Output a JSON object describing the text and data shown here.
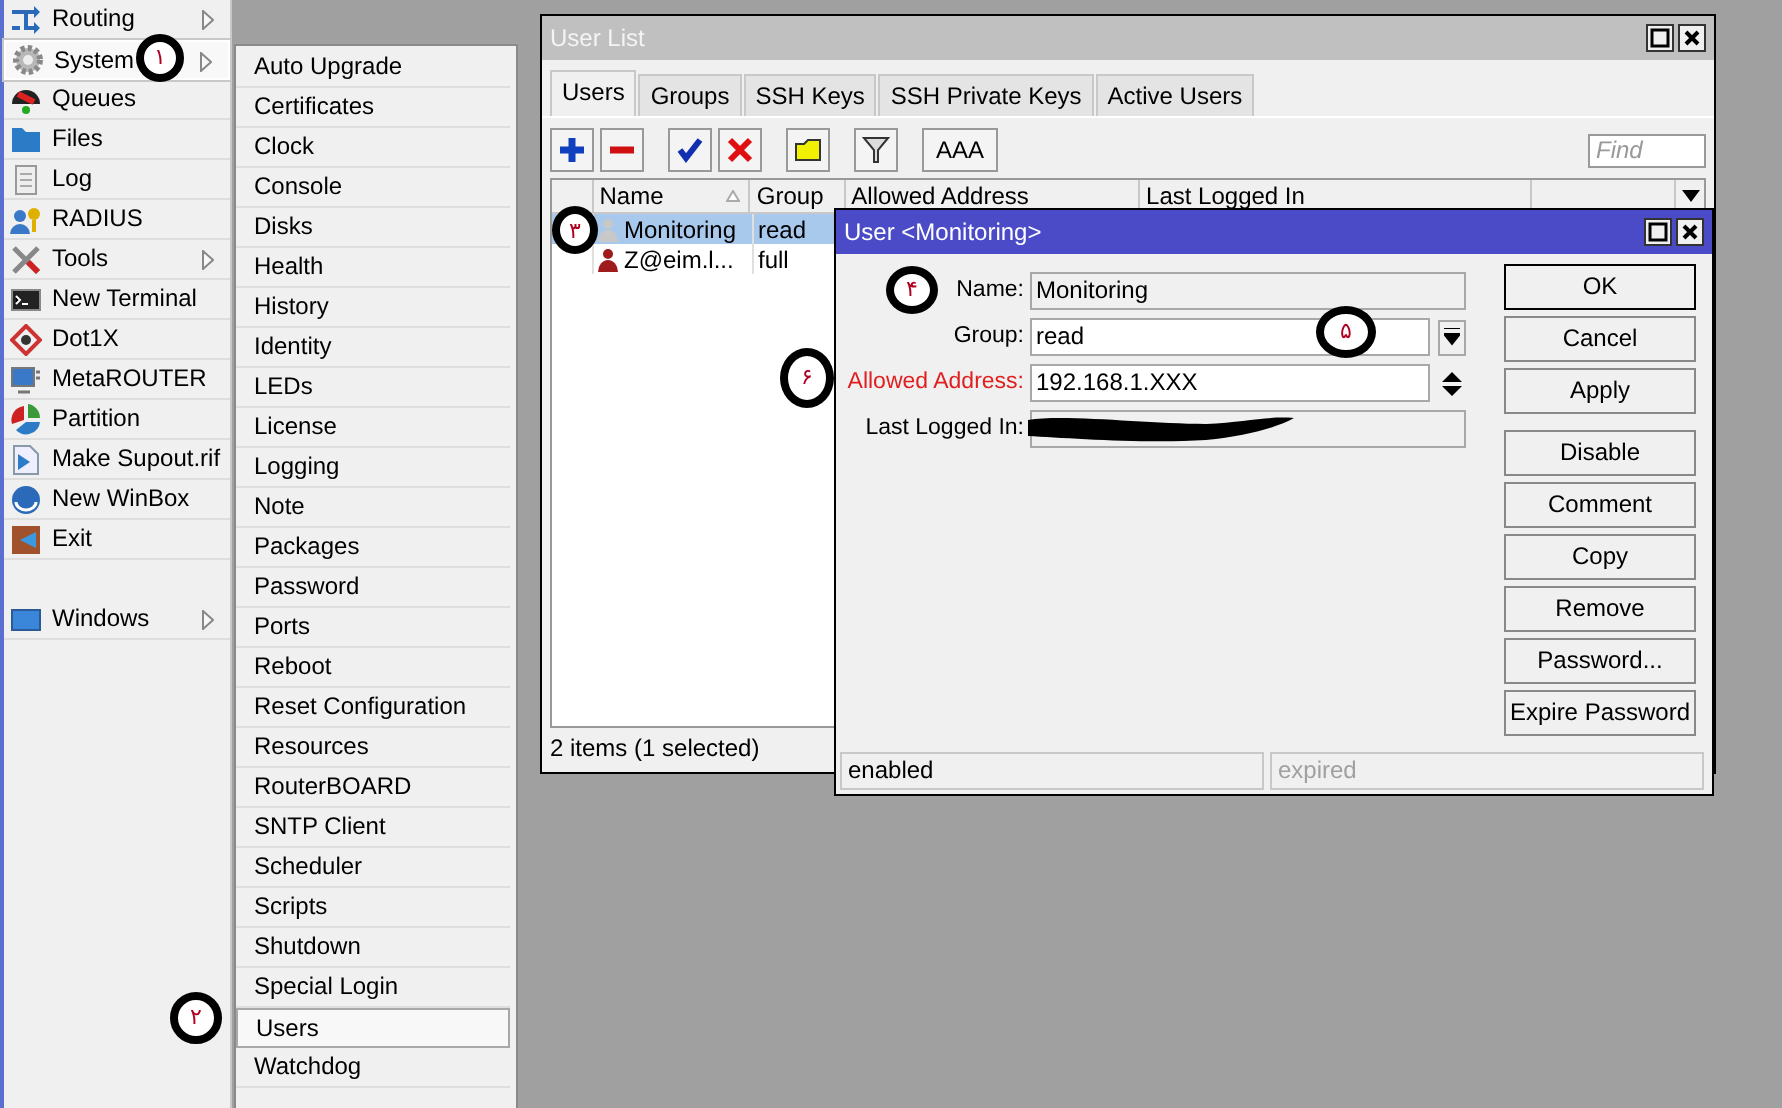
{
  "main_menu": [
    {
      "label": "Routing",
      "submenu": true,
      "selected": false
    },
    {
      "label": "System",
      "submenu": true,
      "selected": true,
      "annotation": "۱"
    },
    {
      "label": "Queues",
      "submenu": false,
      "selected": false
    },
    {
      "label": "Files",
      "submenu": false,
      "selected": false
    },
    {
      "label": "Log",
      "submenu": false,
      "selected": false
    },
    {
      "label": "RADIUS",
      "submenu": false,
      "selected": false
    },
    {
      "label": "Tools",
      "submenu": true,
      "selected": false
    },
    {
      "label": "New Terminal",
      "submenu": false,
      "selected": false
    },
    {
      "label": "Dot1X",
      "submenu": false,
      "selected": false
    },
    {
      "label": "MetaROUTER",
      "submenu": false,
      "selected": false
    },
    {
      "label": "Partition",
      "submenu": false,
      "selected": false
    },
    {
      "label": "Make Supout.rif",
      "submenu": false,
      "selected": false
    },
    {
      "label": "New WinBox",
      "submenu": false,
      "selected": false
    },
    {
      "label": "Exit",
      "submenu": false,
      "selected": false
    },
    {
      "label": "Windows",
      "submenu": true,
      "selected": false
    }
  ],
  "system_submenu": [
    {
      "label": "Auto Upgrade",
      "selected": false
    },
    {
      "label": "Certificates",
      "selected": false
    },
    {
      "label": "Clock",
      "selected": false
    },
    {
      "label": "Console",
      "selected": false
    },
    {
      "label": "Disks",
      "selected": false
    },
    {
      "label": "Health",
      "selected": false
    },
    {
      "label": "History",
      "selected": false
    },
    {
      "label": "Identity",
      "selected": false
    },
    {
      "label": "LEDs",
      "selected": false
    },
    {
      "label": "License",
      "selected": false
    },
    {
      "label": "Logging",
      "selected": false
    },
    {
      "label": "Note",
      "selected": false
    },
    {
      "label": "Packages",
      "selected": false
    },
    {
      "label": "Password",
      "selected": false
    },
    {
      "label": "Ports",
      "selected": false
    },
    {
      "label": "Reboot",
      "selected": false
    },
    {
      "label": "Reset Configuration",
      "selected": false
    },
    {
      "label": "Resources",
      "selected": false
    },
    {
      "label": "RouterBOARD",
      "selected": false
    },
    {
      "label": "SNTP Client",
      "selected": false
    },
    {
      "label": "Scheduler",
      "selected": false
    },
    {
      "label": "Scripts",
      "selected": false
    },
    {
      "label": "Shutdown",
      "selected": false
    },
    {
      "label": "Special Login",
      "selected": false
    },
    {
      "label": "Users",
      "selected": true,
      "annotation": "۲"
    },
    {
      "label": "Watchdog",
      "selected": false
    }
  ],
  "user_list_window": {
    "title": "User List",
    "tabs": [
      {
        "label": "Users",
        "selected": true
      },
      {
        "label": "Groups",
        "selected": false
      },
      {
        "label": "SSH Keys",
        "selected": false
      },
      {
        "label": "SSH Private Keys",
        "selected": false
      },
      {
        "label": "Active Users",
        "selected": false
      }
    ],
    "toolbar": {
      "text_button": "AAA",
      "find": {
        "placeholder": "Find"
      }
    },
    "table": {
      "columns": [
        "Name",
        "Group",
        "Allowed Address",
        "Last Logged In"
      ],
      "rows": [
        {
          "name": "Monitoring",
          "group": "read",
          "selected": true,
          "color": "#c8c8c8",
          "annotation": "۳"
        },
        {
          "name": "Z@eim.l...",
          "group": "full",
          "selected": false,
          "color": "#a01c1c"
        }
      ]
    },
    "status": "2 items (1 selected)"
  },
  "user_dialog": {
    "title": "User <Monitoring>",
    "fields": [
      {
        "kind": "readonly",
        "label": "Name:",
        "value": "Monitoring",
        "highlighted": false,
        "annotation": "۴"
      },
      {
        "kind": "select",
        "label": "Group:",
        "value": "read",
        "highlighted": false,
        "annotation": "۵"
      },
      {
        "kind": "spinner",
        "label": "Allowed Address:",
        "value": "192.168.1.XXX",
        "highlighted": true,
        "annotation": "۶"
      },
      {
        "kind": "redacted",
        "label": "Last Logged In:",
        "highlighted": false
      }
    ],
    "button_groups": [
      [
        {
          "label": "OK",
          "default": true
        },
        {
          "label": "Cancel",
          "default": false
        },
        {
          "label": "Apply",
          "default": false
        }
      ],
      [
        {
          "label": "Disable",
          "default": false
        },
        {
          "label": "Comment",
          "default": false
        },
        {
          "label": "Copy",
          "default": false
        },
        {
          "label": "Remove",
          "default": false
        },
        {
          "label": "Password...",
          "default": false
        },
        {
          "label": "Expire Password",
          "default": false
        }
      ]
    ],
    "status": [
      {
        "text": "enabled",
        "disabled": false
      },
      {
        "text": "expired",
        "disabled": true
      }
    ]
  }
}
